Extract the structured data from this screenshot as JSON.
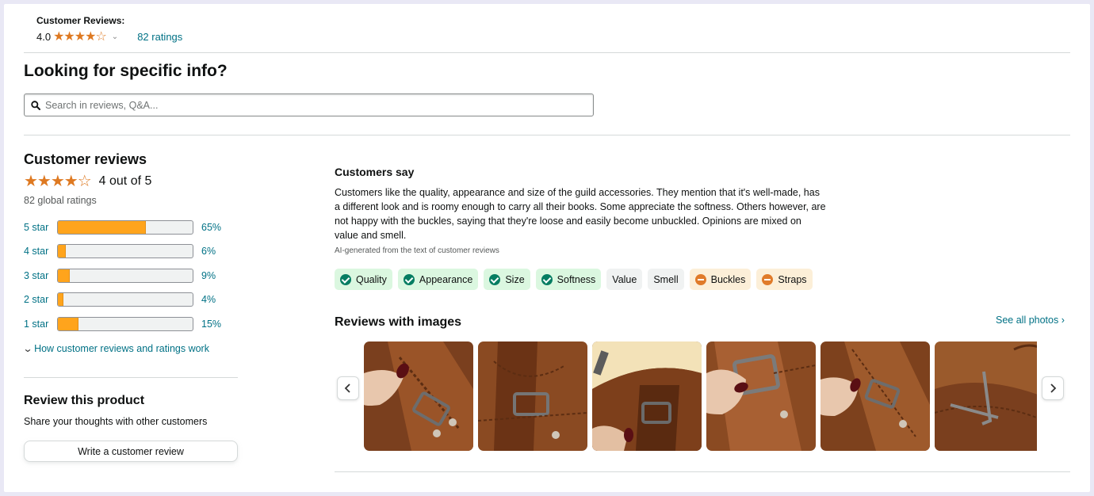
{
  "summary": {
    "title": "Customer Reviews:",
    "score": "4.0",
    "stars": "★★★★☆",
    "ratings_link": "82 ratings"
  },
  "search": {
    "heading": "Looking for specific info?",
    "placeholder": "Search in reviews, Q&A..."
  },
  "customer_reviews": {
    "title": "Customer reviews",
    "stars": "★★★★☆",
    "out_of": "4 out of 5",
    "global": "82 global ratings",
    "histogram": [
      {
        "label": "5 star",
        "percent": 65,
        "percent_text": "65%"
      },
      {
        "label": "4 star",
        "percent": 6,
        "percent_text": "6%"
      },
      {
        "label": "3 star",
        "percent": 9,
        "percent_text": "9%"
      },
      {
        "label": "2 star",
        "percent": 4,
        "percent_text": "4%"
      },
      {
        "label": "1 star",
        "percent": 15,
        "percent_text": "15%"
      }
    ],
    "how_link": "How customer reviews and ratings work"
  },
  "review_product": {
    "title": "Review this product",
    "subtitle": "Share your thoughts with other customers",
    "button": "Write a customer review"
  },
  "customers_say": {
    "title": "Customers say",
    "text": "Customers like the quality, appearance and size of the guild accessories. They mention that it's well-made, has a different look and is roomy enough to carry all their books. Some appreciate the softness. Others however, are not happy with the buckles, saying that they're loose and easily become unbuckled. Opinions are mixed on value and smell.",
    "ai_note": "AI-generated from the text of customer reviews",
    "chips": [
      {
        "label": "Quality",
        "sentiment": "positive",
        "icon": "check-circle-icon"
      },
      {
        "label": "Appearance",
        "sentiment": "positive",
        "icon": "check-circle-icon"
      },
      {
        "label": "Size",
        "sentiment": "positive",
        "icon": "check-circle-icon"
      },
      {
        "label": "Softness",
        "sentiment": "positive",
        "icon": "check-circle-icon"
      },
      {
        "label": "Value",
        "sentiment": "mixed",
        "icon": ""
      },
      {
        "label": "Smell",
        "sentiment": "mixed",
        "icon": ""
      },
      {
        "label": "Buckles",
        "sentiment": "negative",
        "icon": "minus-circle-icon"
      },
      {
        "label": "Straps",
        "sentiment": "negative",
        "icon": "minus-circle-icon"
      }
    ]
  },
  "reviews_with_images": {
    "title": "Reviews with images",
    "see_all": "See all photos ›",
    "image_count": 6,
    "prev_icon": "chevron-left-icon",
    "next_icon": "chevron-right-icon"
  },
  "colors": {
    "link": "#007185",
    "star": "#de7921",
    "bar_fill": "#ffa41c",
    "positive_chip": "#dbf7e0",
    "negative_chip": "#fcefd8",
    "leather": "#8b4a22"
  }
}
